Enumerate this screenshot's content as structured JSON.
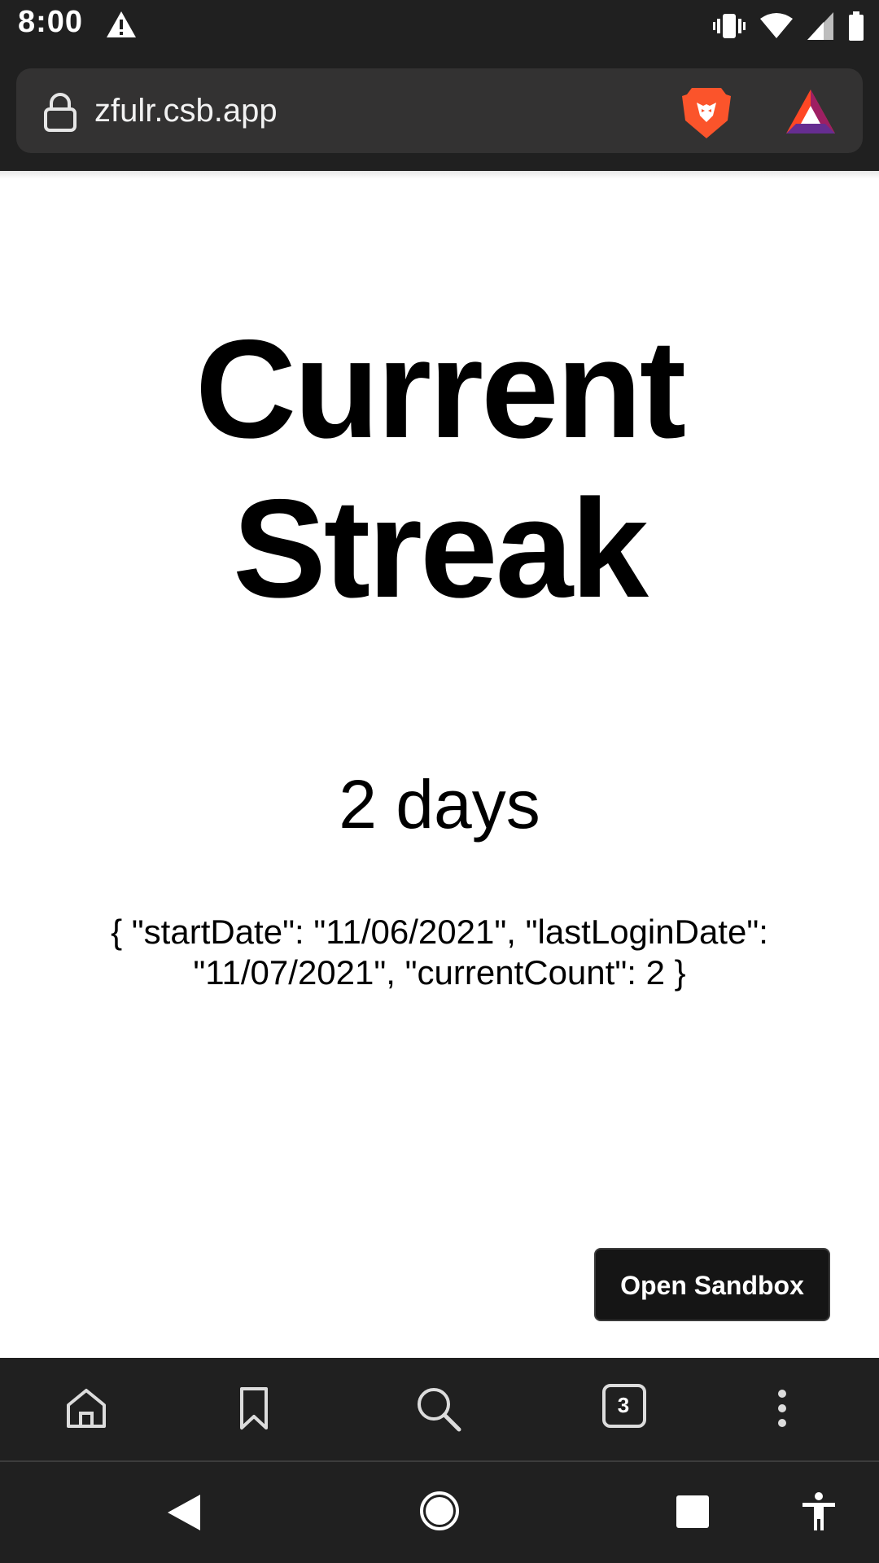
{
  "status_bar": {
    "time": "8:00",
    "icons": [
      "warning-icon",
      "vibrate-icon",
      "wifi-icon",
      "signal-icon",
      "battery-icon"
    ]
  },
  "browser": {
    "url": "zfulr.csb.app",
    "icons": [
      "lock-icon",
      "brave-shields-icon",
      "bat-rewards-icon"
    ],
    "bottom_bar": {
      "items": [
        "home-icon",
        "bookmark-icon",
        "search-icon",
        "tabs-icon",
        "more-icon"
      ],
      "tab_count": "3"
    }
  },
  "page": {
    "title_line1": "Current",
    "title_line2": "Streak",
    "streak_text": "2 days",
    "json_line1": "{ \"startDate\": \"11/06/2021\", \"lastLoginDate\":",
    "json_line2": "\"11/07/2021\", \"currentCount\": 2 }",
    "open_sandbox_label": "Open Sandbox"
  },
  "nav_bar": {
    "items": [
      "back-icon",
      "home-circle-icon",
      "recents-icon",
      "accessibility-icon"
    ]
  },
  "colors": {
    "chrome_background": "#202020",
    "url_bar": "#333232",
    "page_background": "#ffffff",
    "button_background": "#151515",
    "brave_orange": "#fb542b",
    "bat_purple": "#662d91"
  }
}
